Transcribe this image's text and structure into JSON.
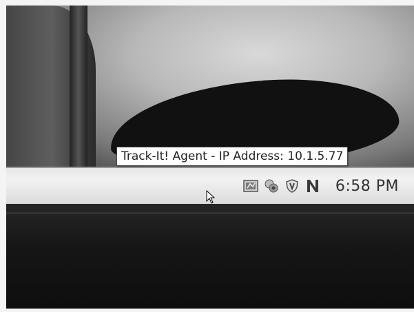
{
  "tooltip": {
    "text": "Track-It! Agent - IP Address: 10.1.5.77"
  },
  "tray": {
    "icons": [
      "track-it-agent-icon",
      "network-connections-icon",
      "security-shield-icon",
      "n-app-icon"
    ],
    "clock": "6:58 PM"
  }
}
